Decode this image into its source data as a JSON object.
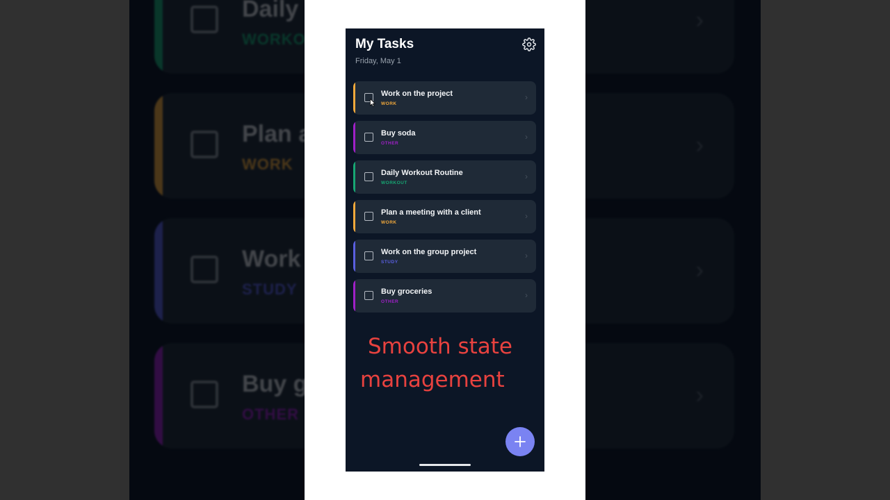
{
  "app": {
    "title": "My Tasks",
    "date": "Friday, May 1"
  },
  "tasks": [
    {
      "title": "Work on the project",
      "tag": "WORK",
      "color": "#f2a93b"
    },
    {
      "title": "Buy soda",
      "tag": "OTHER",
      "color": "#a020c8"
    },
    {
      "title": "Daily Workout Routine",
      "tag": "WORKOUT",
      "color": "#17a773"
    },
    {
      "title": "Plan a meeting with a client",
      "tag": "WORK",
      "color": "#f2a93b"
    },
    {
      "title": "Work on the group project",
      "tag": "STUDY",
      "color": "#5a5fe0"
    },
    {
      "title": "Buy groceries",
      "tag": "OTHER",
      "color": "#a020c8"
    }
  ],
  "background_zoom": [
    {
      "title": "Daily W",
      "tag": "WORKO",
      "color": "#17a773"
    },
    {
      "title": "Plan a",
      "tag": "WORK",
      "color": "#f2a93b"
    },
    {
      "title": "Work",
      "tag": "STUDY",
      "color": "#5a5fe0"
    },
    {
      "title": "Buy g",
      "tag": "OTHER",
      "color": "#a020c8"
    }
  ],
  "overlay": {
    "line1": "Smooth state",
    "line2": "management"
  },
  "icons": {
    "settings": "gear-icon",
    "fab": "plus-icon",
    "chevron": "chevron-right-icon"
  }
}
